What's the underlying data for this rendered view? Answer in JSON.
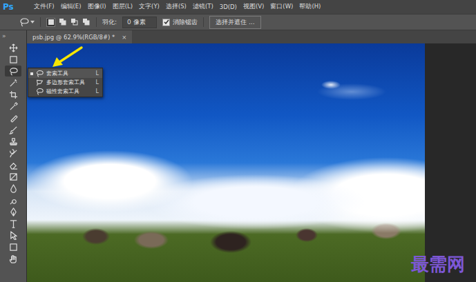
{
  "app": {
    "logo": "Ps"
  },
  "menu": [
    "文件(F)",
    "编辑(E)",
    "图像(I)",
    "图层(L)",
    "文字(Y)",
    "选择(S)",
    "滤镜(T)",
    "3D(D)",
    "视图(V)",
    "窗口(W)",
    "帮助(H)"
  ],
  "options_bar": {
    "feather_label": "羽化:",
    "feather_value": "0 像素",
    "anti_alias": {
      "label": "消除锯齿",
      "checked": true
    },
    "select_mask_button": "选择并遮住 ..."
  },
  "document_tab": {
    "title": "psb.jpg @ 62.9%(RGB/8#) *",
    "close": "×",
    "selected": true
  },
  "toolbar": {
    "collapse": "»"
  },
  "flyout": {
    "items": [
      {
        "label": "套索工具",
        "shortcut": "L",
        "selected": true
      },
      {
        "label": "多边形套索工具",
        "shortcut": "L",
        "selected": false
      },
      {
        "label": "磁性套索工具",
        "shortcut": "L",
        "selected": false
      }
    ]
  },
  "watermark": "最需网"
}
